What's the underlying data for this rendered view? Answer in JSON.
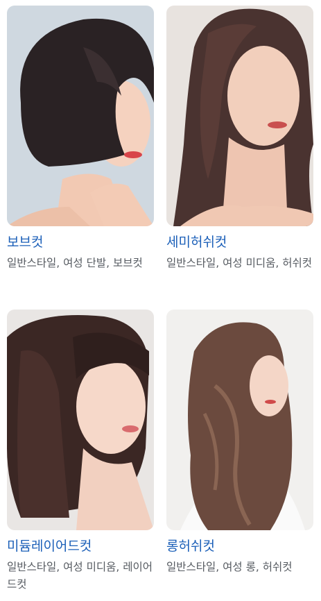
{
  "cards": [
    {
      "title": "보브컷",
      "tags": "일반스타일, 여성 단발, 보브컷"
    },
    {
      "title": "세미허쉬컷",
      "tags": "일반스타일, 여성 미디움, 허쉬컷"
    },
    {
      "title": "미듐레이어드컷",
      "tags": "일반스타일, 여성 미디움, 레이어드컷"
    },
    {
      "title": "롱허쉬컷",
      "tags": "일반스타일, 여성 롱, 허쉬컷"
    }
  ],
  "colors": {
    "title": "#1b5fb8",
    "tags": "#555a60"
  }
}
